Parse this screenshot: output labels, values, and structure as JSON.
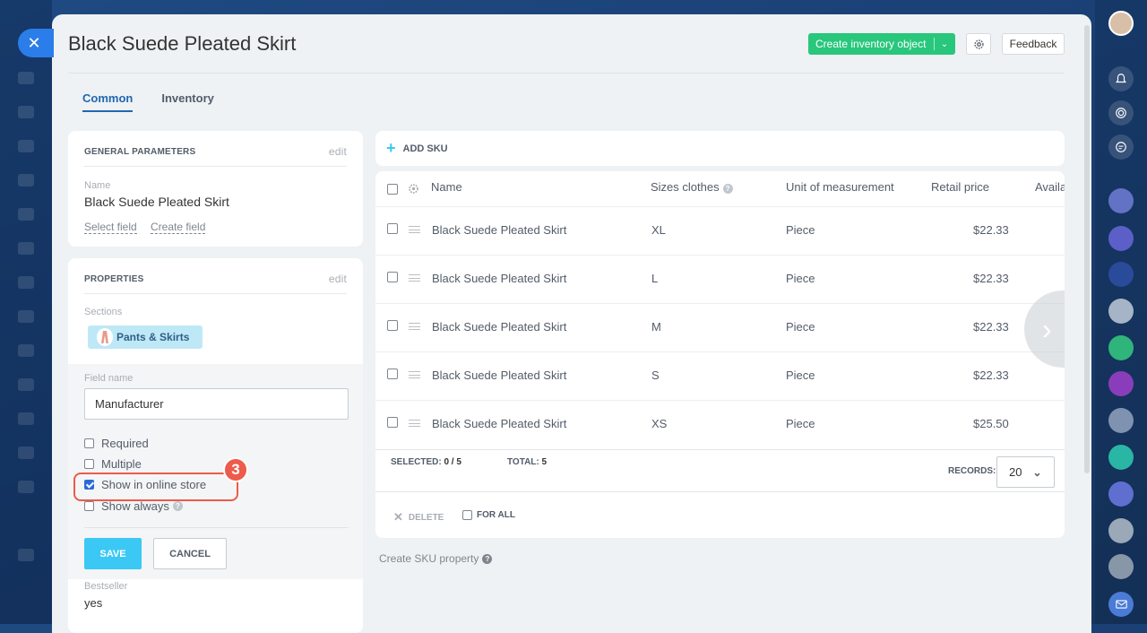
{
  "window": {
    "title": "Black Suede Pleated Skirt"
  },
  "header": {
    "create_label": "Create inventory object",
    "feedback_label": "Feedback"
  },
  "tabs": [
    {
      "label": "Common",
      "active": true
    },
    {
      "label": "Inventory",
      "active": false
    }
  ],
  "general": {
    "heading": "GENERAL PARAMETERS",
    "edit_label": "edit",
    "name_label": "Name",
    "name_value": "Black Suede Pleated Skirt",
    "select_field": "Select field",
    "create_field": "Create field"
  },
  "properties": {
    "heading": "PROPERTIES",
    "edit_label": "edit",
    "sections_label": "Sections",
    "section_value": "Pants & Skirts",
    "field_name_label": "Field name",
    "field_name_value": "Manufacturer",
    "options": [
      {
        "label": "Required",
        "checked": false
      },
      {
        "label": "Multiple",
        "checked": false
      },
      {
        "label": "Show in online store",
        "checked": true
      },
      {
        "label": "Show always",
        "checked": false
      }
    ],
    "save_label": "SAVE",
    "cancel_label": "CANCEL",
    "bestseller_label": "Bestseller",
    "bestseller_value": "yes",
    "step_badge": "3"
  },
  "sku": {
    "add_label": "ADD SKU",
    "columns": [
      "Name",
      "Sizes clothes",
      "Unit of measurement",
      "Retail price",
      "Availa"
    ],
    "rows": [
      {
        "name": "Black Suede Pleated Skirt",
        "size": "XL",
        "unit": "Piece",
        "price": "$22.33"
      },
      {
        "name": "Black Suede Pleated Skirt",
        "size": "L",
        "unit": "Piece",
        "price": "$22.33"
      },
      {
        "name": "Black Suede Pleated Skirt",
        "size": "M",
        "unit": "Piece",
        "price": "$22.33"
      },
      {
        "name": "Black Suede Pleated Skirt",
        "size": "S",
        "unit": "Piece",
        "price": "$22.33"
      },
      {
        "name": "Black Suede Pleated Skirt",
        "size": "XS",
        "unit": "Piece",
        "price": "$25.50"
      }
    ],
    "selected_label": "SELECTED:",
    "selected_value": "0 / 5",
    "total_label": "TOTAL:",
    "total_value": "5",
    "records_label": "RECORDS:",
    "records_value": "20",
    "delete_label": "DELETE",
    "for_all_label": "FOR ALL",
    "create_prop_label": "Create SKU property"
  },
  "colors": {
    "accent": "#2067b0",
    "create_btn": "#29c77c",
    "save_btn": "#3bc8f5",
    "highlight": "#ee5a4b"
  },
  "icons": [
    "close-icon",
    "gear-icon",
    "plus-icon",
    "chevron-right-icon",
    "help-icon",
    "bell-icon",
    "avatar"
  ]
}
